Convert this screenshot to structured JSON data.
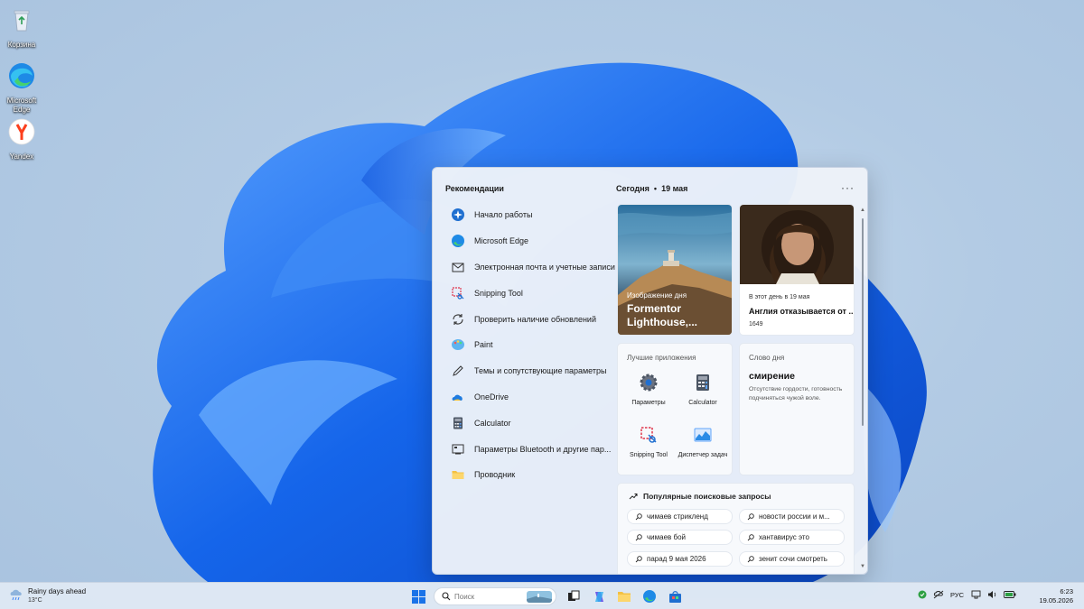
{
  "desktop": {
    "icons": [
      {
        "label": "Корзина",
        "icon": "recycle-bin-icon"
      },
      {
        "label": "Microsoft Edge",
        "icon": "edge-icon"
      },
      {
        "label": "Yandex",
        "icon": "yandex-icon"
      }
    ]
  },
  "widgets": {
    "recommendations": {
      "title": "Рекомендации",
      "items": [
        {
          "label": "Начало работы",
          "icon": "get-started-icon"
        },
        {
          "label": "Microsoft Edge",
          "icon": "edge-icon"
        },
        {
          "label": "Электронная почта и учетные записи",
          "icon": "mail-icon"
        },
        {
          "label": "Snipping Tool",
          "icon": "snipping-tool-icon"
        },
        {
          "label": "Проверить наличие обновлений",
          "icon": "update-icon"
        },
        {
          "label": "Paint",
          "icon": "paint-icon"
        },
        {
          "label": "Темы и сопутствующие параметры",
          "icon": "pen-icon"
        },
        {
          "label": "OneDrive",
          "icon": "onedrive-icon"
        },
        {
          "label": "Calculator",
          "icon": "calculator-icon"
        },
        {
          "label": "Параметры Bluetooth и другие пар...",
          "icon": "bluetooth-settings-icon"
        },
        {
          "label": "Проводник",
          "icon": "folder-icon"
        }
      ]
    },
    "today": {
      "label": "Сегодня",
      "separator": "•",
      "date": "19 мая"
    },
    "more_label": "···",
    "photo_card": {
      "caption": "Изображение дня",
      "title": "Formentor Lighthouse,..."
    },
    "history_card": {
      "caption": "В этот день в 19 мая",
      "title": "Англия отказывается от ...",
      "year": "1649"
    },
    "apps_card": {
      "title": "Лучшие приложения",
      "apps": [
        {
          "label": "Параметры",
          "icon": "settings-icon"
        },
        {
          "label": "Calculator",
          "icon": "calculator-icon"
        },
        {
          "label": "Snipping Tool",
          "icon": "snipping-tool-icon"
        },
        {
          "label": "Диспетчер задач",
          "icon": "task-manager-icon"
        }
      ]
    },
    "word_card": {
      "title": "Слово дня",
      "word": "смирение",
      "definition": "Отсутствие гордости, готовность подчиняться чужой воле."
    },
    "trending": {
      "title": "Популярные поисковые запросы",
      "queries": [
        "чимаев стрикленд",
        "новости россии и м...",
        "чимаев бой",
        "хантавирус это",
        "парад 9 мая 2026",
        "зенит сочи смотреть"
      ]
    }
  },
  "taskbar": {
    "weather": {
      "summary": "Rainy days ahead",
      "temp": "13°C"
    },
    "search_placeholder": "Поиск",
    "language": "РУС",
    "time": "6:23",
    "date": "19.05.2026"
  },
  "colors": {
    "accent": "#0067c0",
    "wallpaper_blue": "#1f6fe8"
  }
}
